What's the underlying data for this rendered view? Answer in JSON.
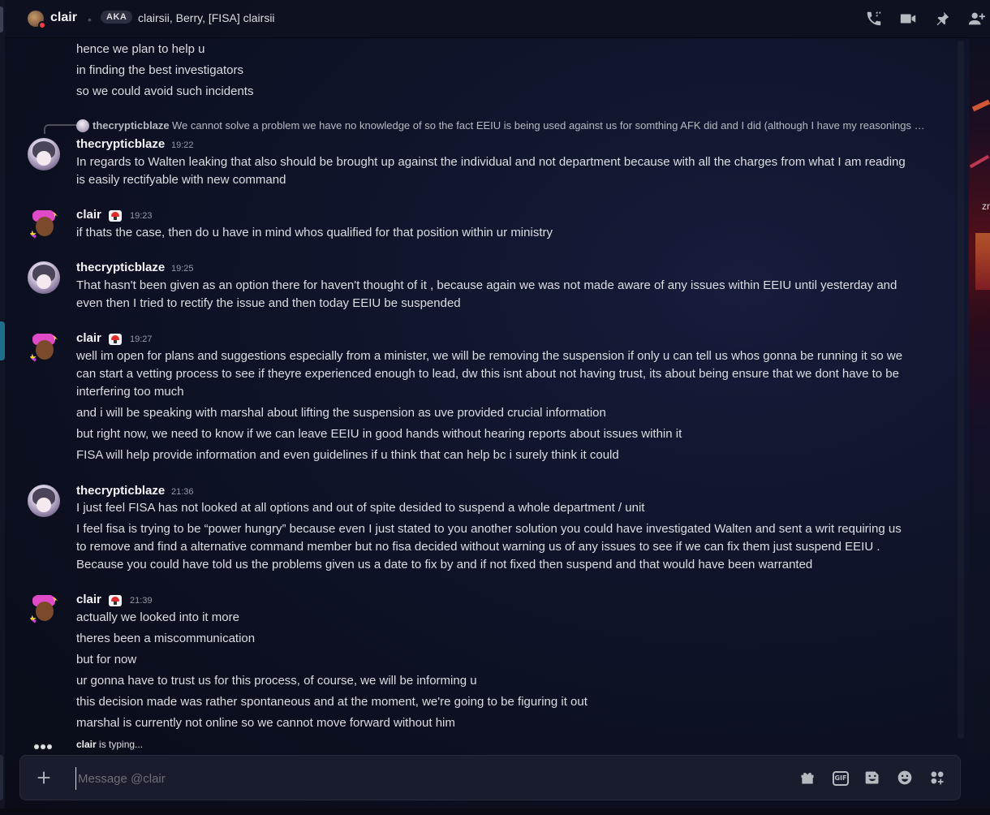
{
  "header": {
    "name": "clair",
    "aka_label": "AKA",
    "aka_names": "clairsii, Berry, [FISA] clairsii",
    "icons": [
      "phone-icon",
      "video-icon",
      "pin-icon",
      "add-friend-icon"
    ]
  },
  "side_panel": {
    "text": "zn"
  },
  "messages": {
    "continued": [
      "hence we plan to help u",
      "in finding the best investigators",
      "so we could avoid such incidents"
    ],
    "reply": {
      "author": "thecrypticblaze",
      "text": "We cannot solve a problem we have no knowledge of so the fact EEIU  is being used against us for somthing AFK did and I did (although I have my reasonings …"
    },
    "groups": [
      {
        "author": "thecrypticblaze",
        "time": "19:22",
        "lines": [
          "In regards to Walten leaking that also should be brought up against the individual and not department because with all the charges from what I am reading",
          "is easily rectifyable with new command"
        ]
      },
      {
        "author": "clair",
        "time": "19:23",
        "lines": [
          "if thats the case, then do u have in mind whos qualified for that position within ur ministry"
        ]
      },
      {
        "author": "thecrypticblaze",
        "time": "19:25",
        "lines": [
          "That hasn't been given as an option there for haven't thought of it , because again we was not made aware of any issues within EEIU until yesterday and",
          "even then I tried to rectify the issue and then today EEIU be suspended"
        ]
      },
      {
        "author": "clair",
        "time": "19:27",
        "lines": [
          "well im open for plans and suggestions especially from a minister, we will be removing the suspension if only u can tell us whos gonna be running it so we",
          "can start a vetting process to see if theyre experienced enough to lead, dw this isnt about not having trust, its about being ensure that we dont have to be",
          "interfering too much",
          "and i will be speaking with marshal about lifting the suspension as uve provided crucial information",
          "but right now, we need to know if we can leave EEIU in good hands without hearing reports about issues within it",
          "FISA will help provide information and even guidelines if u think that can help bc i surely think it could"
        ]
      },
      {
        "author": "thecrypticblaze",
        "time": "21:36",
        "lines": [
          "I just feel FISA has not looked at all options and out of spite desided to suspend a whole department / unit",
          "I feel fisa is trying to be “power hungry” because even I just stated to you another solution you could have investigated Walten and sent a writ requiring us",
          "to remove and find a alternative command member but no fisa decided without warning us of any issues to see if we can fix them just suspend EEIU .",
          "Because you could have told us the problems given us a date to fix by and if not fixed then suspend and that would have been warranted"
        ]
      },
      {
        "author": "clair",
        "time": "21:39",
        "lines": [
          "actually we looked into it more",
          "theres been a miscommunication",
          "but for now",
          "ur gonna have to trust us for this process, of course, we will be informing u",
          "this decision made was rather spontaneous and at the moment, we're going to be figuring it out",
          "marshal is currently not online so we cannot move forward without him"
        ]
      }
    ]
  },
  "typing": {
    "user": "clair",
    "suffix": " is typing..."
  },
  "composer": {
    "placeholder": "Message @clair",
    "gif_label": "GIF",
    "icons": [
      "plus-icon",
      "gift-icon",
      "gif-icon",
      "sticker-icon",
      "emoji-icon",
      "apps-icon"
    ]
  },
  "colors": {
    "accent_text": "#dbdee1",
    "author": "#f2f3f5",
    "timestamp": "#949ba4",
    "dnd_status": "#f23f43"
  }
}
